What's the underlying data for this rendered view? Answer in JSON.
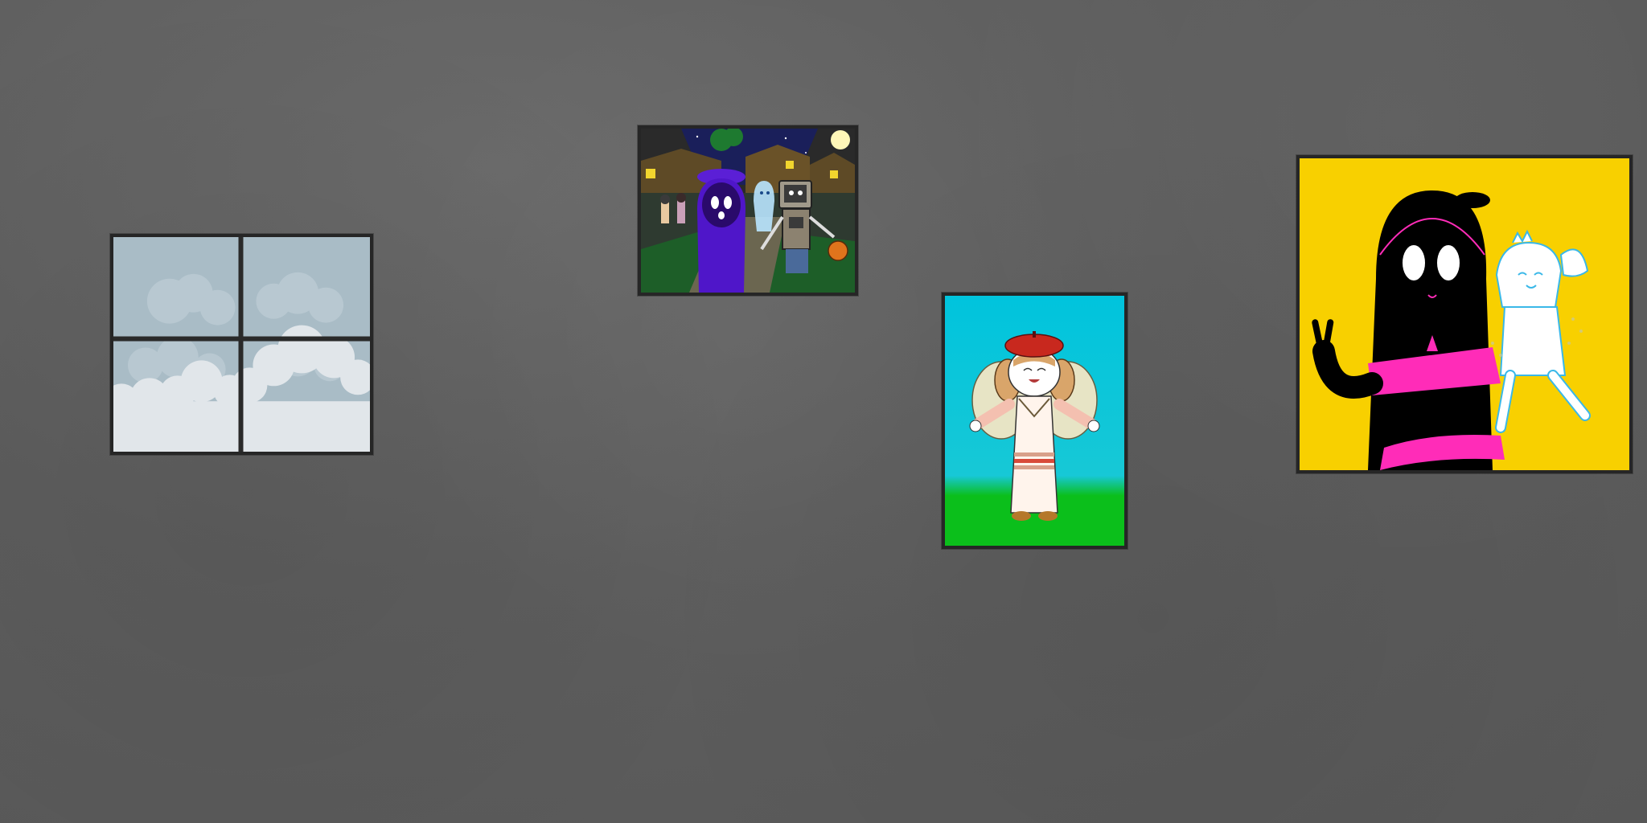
{
  "scene": {
    "wall_color": "#5f5f5f",
    "frame_color": "#262626"
  },
  "window": {
    "icon": "window-icon",
    "sky_color": "#a9bcc6",
    "cloud_color": "#e1e6ea"
  },
  "paintings": [
    {
      "id": "halloween",
      "icon": "halloween-painting-icon"
    },
    {
      "id": "fairy",
      "icon": "fairy-painting-icon",
      "background": "#00c4dd",
      "grass": "#0bbf1b"
    },
    {
      "id": "duo",
      "icon": "duo-painting-icon",
      "background": "#f8d000",
      "accent": "#ff2cb8"
    }
  ]
}
